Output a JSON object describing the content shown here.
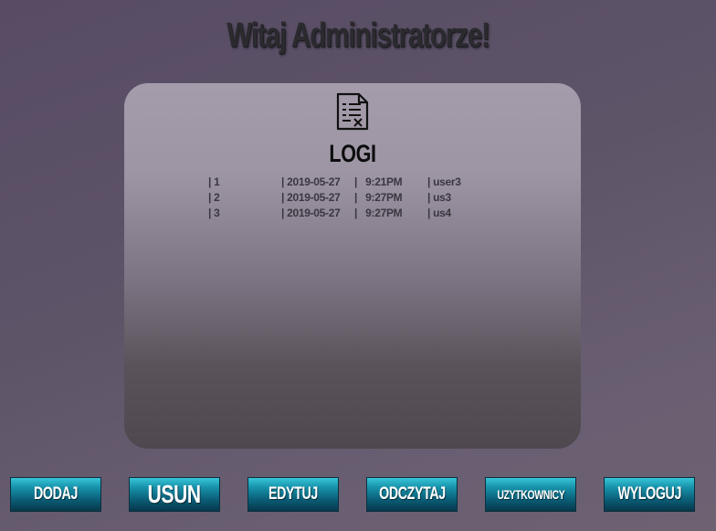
{
  "page": {
    "heading": "Witaj Administratorze!"
  },
  "logs_panel": {
    "icon": "log-document-icon",
    "title": "LOGI",
    "rows": [
      {
        "id": "| 1",
        "date": "| 2019-05-27",
        "time": "|   9:21PM",
        "user": "| user3"
      },
      {
        "id": "| 2",
        "date": "| 2019-05-27",
        "time": "|   9:27PM",
        "user": "| us3"
      },
      {
        "id": "| 3",
        "date": "| 2019-05-27",
        "time": "|   9:27PM",
        "user": "| us4"
      }
    ]
  },
  "nav": {
    "dodaj": "DODAJ",
    "usun": "USUN",
    "edytuj": "EDYTUJ",
    "odczytaj": "ODCZYTAJ",
    "uzytkownicy": "UZYTKOWNICY",
    "wyloguj": "WYLOGUJ"
  },
  "colors": {
    "background": "#5e5468",
    "panel_top": "#a59cab",
    "panel_bottom": "#4f484f",
    "button_top": "#36c6d8",
    "button_bottom": "#07384c",
    "heading": "#2b2b2f"
  }
}
